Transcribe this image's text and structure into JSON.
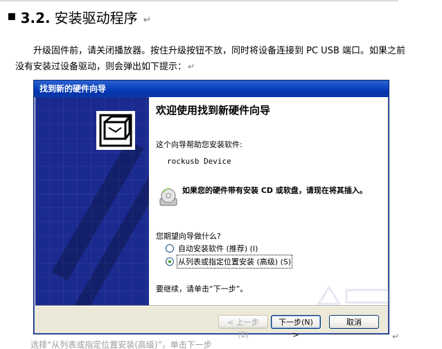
{
  "doc": {
    "heading_number": "3.2.",
    "heading_title": "安装驱动程序",
    "para_mark": "↵",
    "paragraph": "升级固件前，请关闭播放器。按住升级按钮不放，同时将设备连接到 PC USB 端口。如果之前没有安装过设备驱动，则会弹出如下提示：",
    "bottom_partial": "选择“从列表或指定位置安装(高级)”，单击下一步"
  },
  "dialog": {
    "title": "找到新的硬件向导",
    "welcome": "欢迎使用找到新硬件向导",
    "help_text": "这个向导帮助您安装软件:",
    "device_name": "rockusb Device",
    "cd_prompt": "如果您的硬件带有安装 CD 或软盘，请现在将其插入。",
    "question": "您期望向导做什么?",
    "options": [
      {
        "label": "自动安装软件 (推荐) (I)",
        "checked": false
      },
      {
        "label": "从列表或指定位置安装 (高级) (S)",
        "checked": true
      }
    ],
    "continue_text": "要继续，请单击“下一步”。",
    "buttons": {
      "back": "< 上一步(B)",
      "next": "下一步(N) >",
      "cancel": "取消"
    }
  },
  "icons": [
    "hardware-install-icon",
    "cd-disc-icon"
  ],
  "colors": {
    "titlebar": "#0a43be",
    "left_pane": "#1b2a8f",
    "dialog_bg": "#ece9d8"
  }
}
